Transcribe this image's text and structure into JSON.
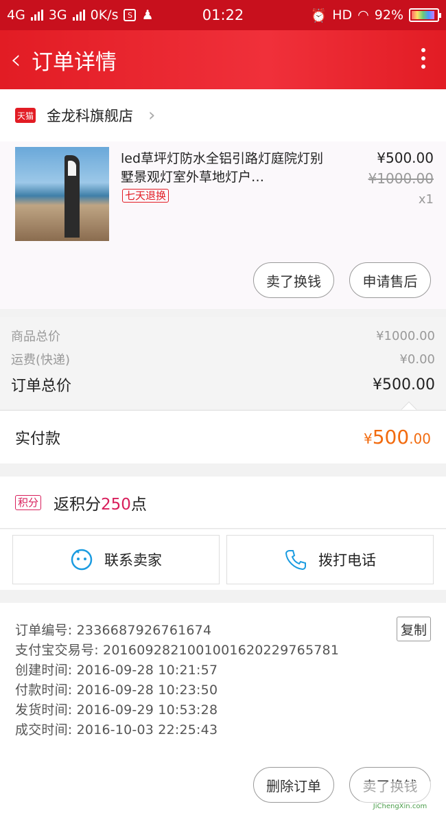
{
  "status_bar": {
    "network1": "4G",
    "network2": "3G",
    "speed": "0K/s",
    "time": "01:22",
    "hd": "HD",
    "battery": "92%"
  },
  "header": {
    "title": "订单详情"
  },
  "shop": {
    "badge": "天猫",
    "name": "金龙科旗舰店"
  },
  "item": {
    "title": "led草坪灯防水全铝引路灯庭院灯别墅景观灯室外草地灯户…",
    "tag": "七天退换",
    "price": "¥500.00",
    "original_price": "¥1000.00",
    "quantity": "x1",
    "sell_button": "卖了换钱",
    "after_sale_button": "申请售后"
  },
  "summary": {
    "goods_total_label": "商品总价",
    "goods_total": "¥1000.00",
    "shipping_label": "运费(快递)",
    "shipping": "¥0.00",
    "order_total_label": "订单总价",
    "order_total": "¥500.00"
  },
  "paid": {
    "label": "实付款",
    "currency": "¥",
    "integer": "500",
    "decimal": ".00"
  },
  "points": {
    "badge": "积分",
    "prefix": "返积分",
    "value": "250",
    "suffix": "点"
  },
  "contact": {
    "seller": "联系卖家",
    "phone": "拨打电话"
  },
  "order_info": {
    "order_no": "订单编号: 2336687926761674",
    "copy_label": "复制",
    "alipay_no": "支付宝交易号: 2016092821001001620229765781",
    "created": "创建时间: 2016-09-28 10:21:57",
    "paid_time": "付款时间: 2016-09-28 10:23:50",
    "shipped": "发货时间: 2016-09-29 10:53:28",
    "completed": "成交时间: 2016-10-03 22:25:43"
  },
  "footer": {
    "delete": "删除订单",
    "sell": "卖了换钱"
  },
  "watermark": {
    "site": "JiChengXin.com"
  },
  "colors": {
    "brand_red": "#e21c24",
    "pay_orange": "#f26b0f",
    "points_pink": "#d81e5b"
  }
}
